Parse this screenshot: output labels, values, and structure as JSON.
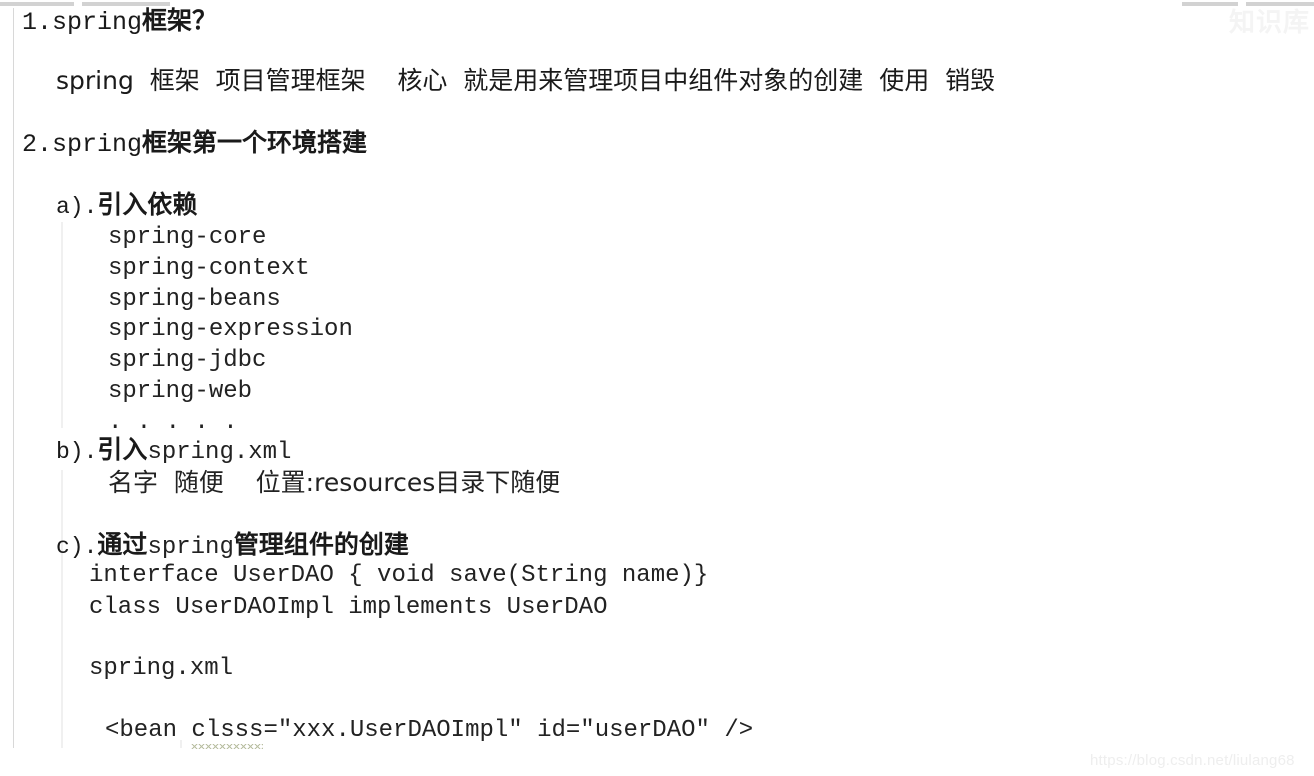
{
  "document": {
    "headings": [
      {
        "id": "h1",
        "number": "1.",
        "latin": "spring",
        "cjk": "框架？"
      },
      {
        "id": "h2",
        "number": "2.",
        "latin": "spring",
        "cjk": "框架第一个环境搭建"
      }
    ],
    "intro_line": "spring  框架  项目管理框架    核心  就是用来管理项目中组件对象的创建  使用  销毁",
    "sections": [
      {
        "marker": "a).",
        "title_cjk": "引入依赖",
        "items": [
          "spring-core",
          "spring-context",
          "spring-beans",
          "spring-expression",
          "spring-jdbc",
          "spring-web",
          ". . . . ."
        ]
      },
      {
        "marker": "b).",
        "title_cjk": "引入",
        "title_latin": "spring.xml",
        "detail": "名字  随便    位置:resources目录下随便"
      },
      {
        "marker": "c).",
        "title_cjk_1": "通过",
        "title_latin": "spring",
        "title_cjk_2": "管理组件的创建",
        "code_lines": [
          "interface UserDAO { void save(String name)}",
          "class UserDAOImpl implements UserDAO"
        ],
        "xml_file": "spring.xml",
        "bean_prefix": "<bean ",
        "bean_misspelled_attr": "clsss",
        "bean_suffix": "=\"xxx.UserDAOImpl\" id=\"userDAO\" />"
      }
    ]
  },
  "watermarks": {
    "top_right": "知识库",
    "bottom_right": "https://blog.csdn.net/liulang68"
  },
  "colors": {
    "page_background": "#ffffff",
    "text": "#1a1a1a",
    "code_text": "#222222",
    "rule": "#d8d8d8",
    "indent_guide": "#f0f0f0",
    "top_strip": "#d2d2d2",
    "spellcheck_squiggle": "#b9bfa2",
    "watermark": "#eeeeee"
  }
}
